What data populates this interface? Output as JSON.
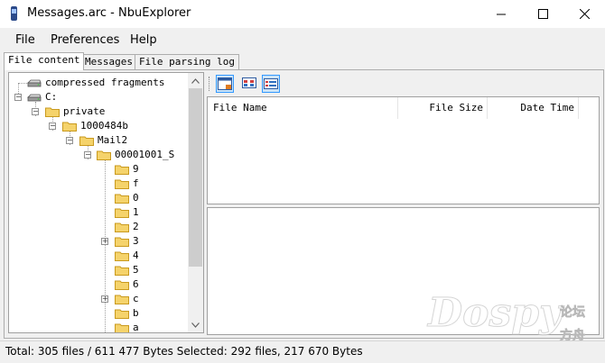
{
  "window": {
    "title": "Messages.arc - NbuExplorer"
  },
  "menu": [
    "File",
    "Preferences",
    "Help"
  ],
  "tabs": [
    "File content",
    "Messages",
    "File parsing log"
  ],
  "tree": {
    "nodes": [
      {
        "label": "compressed fragments",
        "icon": "drive-icon"
      },
      {
        "label": "C:",
        "icon": "drive-icon"
      },
      {
        "label": "private",
        "icon": "folder-icon"
      },
      {
        "label": "1000484b",
        "icon": "folder-icon"
      },
      {
        "label": "Mail2",
        "icon": "folder-icon"
      },
      {
        "label": "00001001_S",
        "icon": "folder-icon"
      },
      {
        "label": "9",
        "icon": "folder-icon"
      },
      {
        "label": "f",
        "icon": "folder-icon"
      },
      {
        "label": "0",
        "icon": "folder-icon"
      },
      {
        "label": "1",
        "icon": "folder-icon"
      },
      {
        "label": "2",
        "icon": "folder-icon"
      },
      {
        "label": "3",
        "icon": "folder-icon"
      },
      {
        "label": "4",
        "icon": "folder-icon"
      },
      {
        "label": "5",
        "icon": "folder-icon"
      },
      {
        "label": "6",
        "icon": "folder-icon"
      },
      {
        "label": "c",
        "icon": "folder-icon"
      },
      {
        "label": "b",
        "icon": "folder-icon"
      },
      {
        "label": "a",
        "icon": "folder-icon"
      }
    ]
  },
  "file_list": {
    "columns": [
      "File Name",
      "File Size",
      "Date Time"
    ]
  },
  "status": {
    "text": "Total: 305 files / 611 477 Bytes  Selected: 292 files, 217 670 Bytes"
  },
  "watermark": {
    "text": "Dospy",
    "cn_top": "论坛",
    "cn_bottom": "方舟"
  },
  "colors": {
    "folder": "#f5d36b",
    "folder_border": "#c99a1e",
    "accent": "#3399ff"
  }
}
